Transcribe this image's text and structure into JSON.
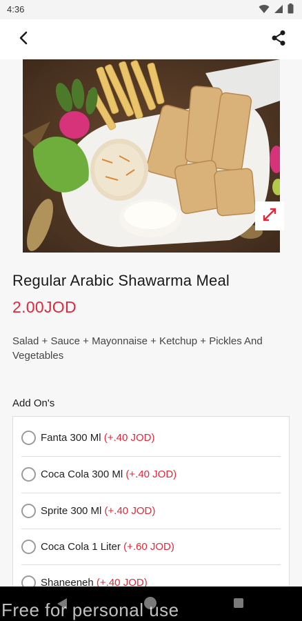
{
  "status_bar": {
    "time": "4:36",
    "icons": [
      "wifi-icon",
      "signal-icon",
      "battery-icon"
    ]
  },
  "app_bar": {
    "back_icon": "back-arrow-icon",
    "share_icon": "share-icon"
  },
  "hero": {
    "image": "shawarma-meal-photo",
    "expand_icon": "expand-icon"
  },
  "product": {
    "title": "Regular Arabic Shawarma Meal",
    "price": "2.00JOD",
    "description": "Salad + Sauce + Mayonnaise + Ketchup + Pickles And Vegetables"
  },
  "addons": {
    "heading": "Add On's",
    "items": [
      {
        "name": "Fanta 300 Ml",
        "extra": "(+.40 JOD)",
        "selected": false
      },
      {
        "name": "Coca Cola 300 Ml",
        "extra": "(+.40 JOD)",
        "selected": false
      },
      {
        "name": "Sprite 300 Ml",
        "extra": "(+.40 JOD)",
        "selected": false
      },
      {
        "name": "Coca Cola 1 Liter",
        "extra": "(+.60 JOD)",
        "selected": false
      },
      {
        "name": "Shaneeneh",
        "extra": "(+.40 JOD)",
        "selected": false
      }
    ]
  },
  "nav_bar": {
    "icons": [
      "nav-back-icon",
      "nav-home-icon",
      "nav-recents-icon"
    ]
  },
  "watermark": "Free for personal use",
  "colors": {
    "accent": "#e0283a",
    "background": "#f7f7f7",
    "nav": "#000000"
  }
}
